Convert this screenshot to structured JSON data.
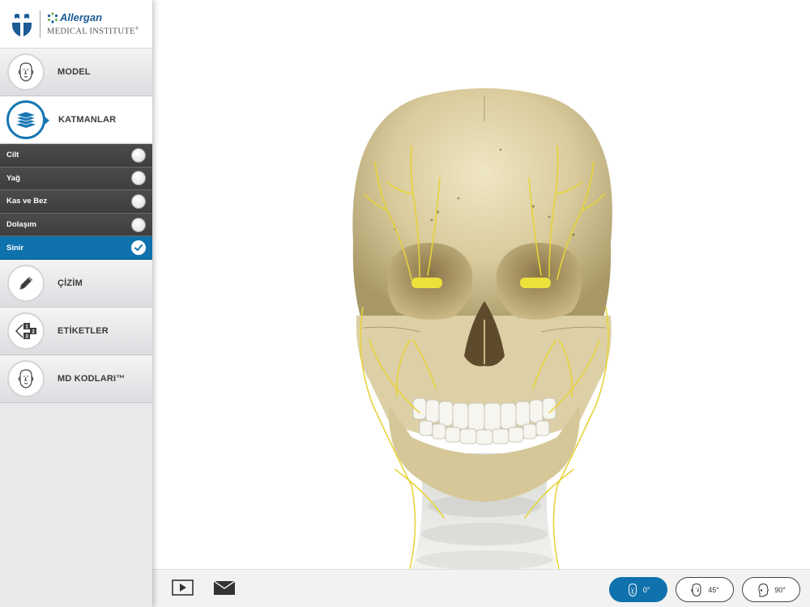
{
  "brand": {
    "name": "Allergan",
    "subtitle": "MEDICAL INSTITUTE",
    "registered": "®"
  },
  "nav": {
    "model": "MODEL",
    "katmanlar": "KATMANLAR",
    "cizim": "ÇİZİM",
    "etiketler": "ETİKETLER",
    "md_kodlari": "MD KODLARI™"
  },
  "layers": [
    {
      "label": "Cilt",
      "checked": false
    },
    {
      "label": "Yağ",
      "checked": false
    },
    {
      "label": "Kas ve Bez",
      "checked": false
    },
    {
      "label": "Dolaşım",
      "checked": false
    },
    {
      "label": "Sinir",
      "checked": true
    }
  ],
  "views": [
    {
      "label": "0°",
      "active": true
    },
    {
      "label": "45°",
      "active": false
    },
    {
      "label": "90°",
      "active": false
    }
  ],
  "colors": {
    "accent": "#1072ad",
    "sidebar_dark": "#4a4a4a",
    "nerve": "#e6d33a",
    "bone": "#e2d6b0"
  },
  "icons": {
    "model": "head-icon",
    "katmanlar": "layers-icon",
    "cizim": "pencil-icon",
    "etiketler": "labels-icon",
    "md_kodlari": "head-icon",
    "play": "play-icon",
    "email": "email-icon"
  }
}
